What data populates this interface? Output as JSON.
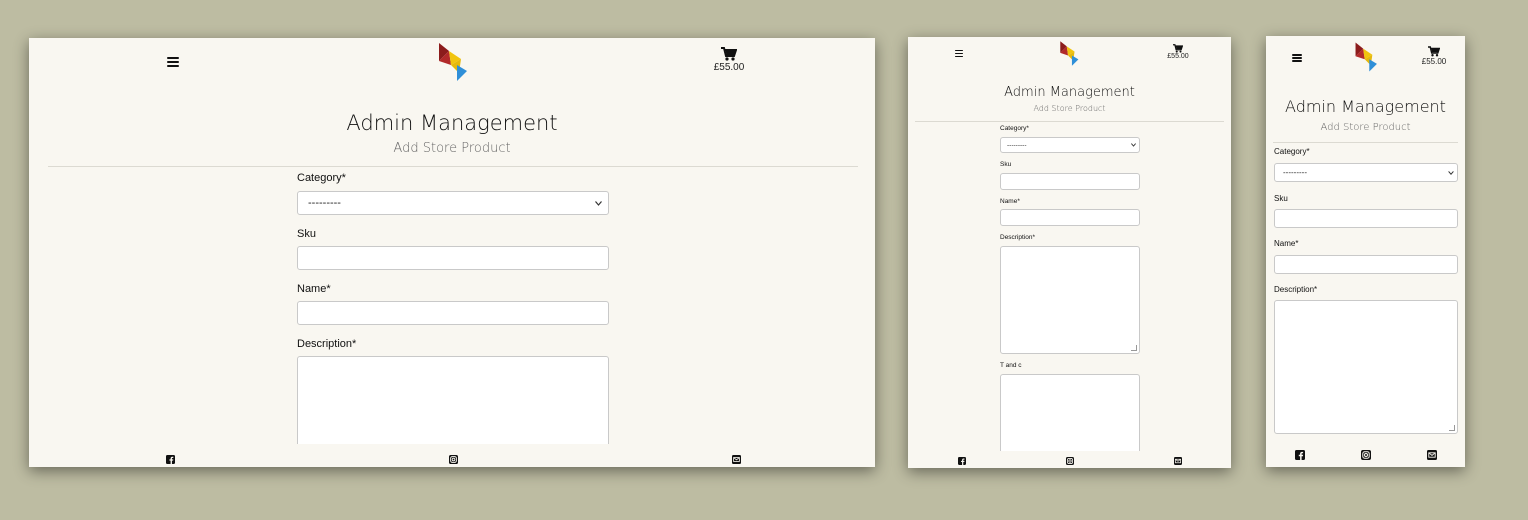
{
  "header": {
    "menu_icon": "hamburger-menu-icon",
    "logo": "multicolor-bird-logo",
    "cart_icon": "shopping-cart-icon",
    "cart_total": "£55.00"
  },
  "page": {
    "title": "Admin Management",
    "subtitle": "Add Store Product"
  },
  "form": {
    "category_label": "Category*",
    "category_selected": "---------",
    "sku_label": "Sku",
    "name_label": "Name*",
    "description_label": "Description*",
    "tandc_label": "T and c"
  },
  "footer": {
    "icons": [
      "facebook-icon",
      "instagram-icon",
      "email-icon"
    ]
  },
  "colors": {
    "background": "#bdbca2",
    "page": "#f9f7f1",
    "logo_red": "#8c1c1c",
    "logo_yellow": "#f1c40f",
    "logo_blue": "#2f8fd8"
  }
}
